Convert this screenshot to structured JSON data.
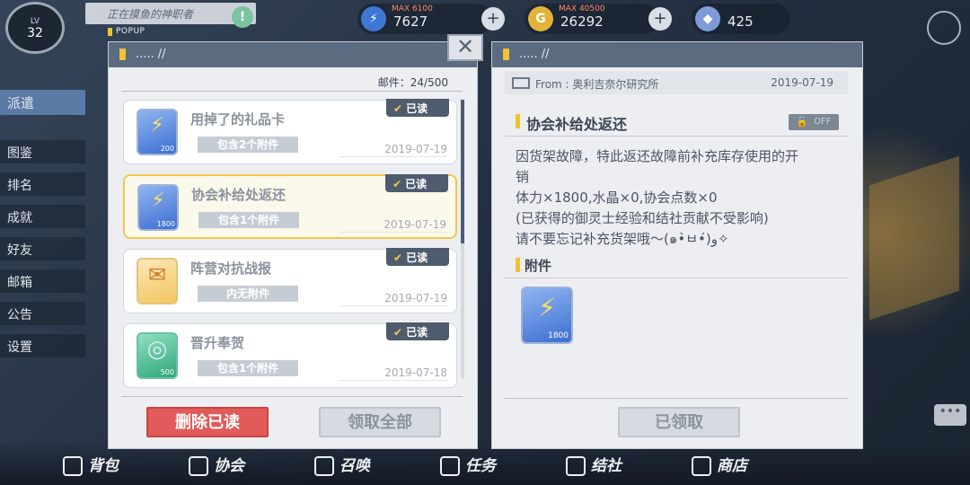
{
  "hud": {
    "level_label": "LV",
    "level": "32",
    "notice": "正在摸鱼的神职者",
    "currencies": [
      {
        "cap": "MAX 6100",
        "value": "7627",
        "icon": "stamina-icon"
      },
      {
        "cap": "MAX 40500",
        "value": "26292",
        "icon": "gold-coin-icon"
      },
      {
        "cap": "",
        "value": "425",
        "icon": "crystal-icon"
      }
    ]
  },
  "side_menu": {
    "dispatch": "派遣",
    "items": [
      "图鉴",
      "排名",
      "成就",
      "好友",
      "邮箱",
      "公告",
      "设置"
    ]
  },
  "bottom_nav": [
    "背包",
    "协会",
    "召唤",
    "任务",
    "结社",
    "商店"
  ],
  "popup_tag": "POPUP",
  "mail_list": {
    "header": "..... //",
    "count_label": "邮件：24/500",
    "items": [
      {
        "title": "用掉了的礼品卡",
        "badge": "包含2个附件",
        "date": "2019-07-19",
        "read": "已读",
        "icon": "stamina-potion-icon",
        "qty": "200"
      },
      {
        "title": "协会补给处返还",
        "badge": "包含1个附件",
        "date": "2019-07-19",
        "read": "已读",
        "icon": "stamina-potion-icon",
        "qty": "1800"
      },
      {
        "title": "阵营对抗战报",
        "badge": "内无附件",
        "date": "2019-07-19",
        "read": "已读",
        "icon": "envelope-icon",
        "qty": ""
      },
      {
        "title": "晋升奉贺",
        "badge": "包含1个附件",
        "date": "2019-07-18",
        "read": "已读",
        "icon": "coin-icon",
        "qty": "500"
      }
    ],
    "delete_read": "删除已读",
    "claim_all": "领取全部"
  },
  "mail_detail": {
    "header": "..... //",
    "from": "From : 奥利吉奈尔研究所",
    "date": "2019-07-19",
    "title": "协会补给处返还",
    "lock_label": "OFF",
    "body": [
      "因货架故障，特此返还故障前补充库存使用的开",
      "销",
      "体力×1800,水晶×0,协会点数×0",
      "(已获得的御灵士经验和结社贡献不受影响)",
      "请不要忘记补充货架哦～(๑•̀ㅂ•́)و✧"
    ],
    "attach_label": "附件",
    "attach_qty": "1800",
    "claimed": "已领取"
  },
  "colors": {
    "accent_yellow": "#f0c330",
    "danger_red": "#e15b5b",
    "header_slate": "#5b6b80"
  }
}
